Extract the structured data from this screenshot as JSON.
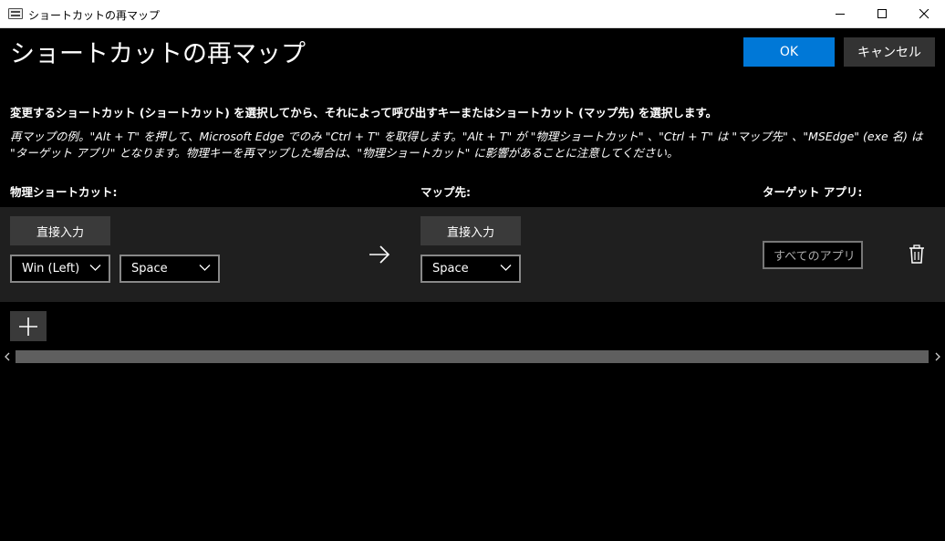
{
  "window": {
    "title": "ショートカットの再マップ",
    "icon": "keyboard-icon"
  },
  "header": {
    "title": "ショートカットの再マップ",
    "ok_label": "OK",
    "cancel_label": "キャンセル",
    "accent_color": "#0078d7"
  },
  "description": "変更するショートカット (ショートカット) を選択してから、それによって呼び出すキーまたはショートカット (マップ先) を選択します。",
  "example": "再マップの例。\"Alt + T\" を押して、Microsoft Edge でのみ \"Ctrl + T\" を取得します。\"Alt + T\" が \"物理ショートカット\" 、\"Ctrl + T\" は \"マップ先\" 、\"MSEdge\" (exe 名) は \"ターゲット アプリ\" となります。物理キーを再マップした場合は、\"物理ショートカット\" に影響があることに注意してください。",
  "columns": {
    "physical": "物理ショートカット:",
    "mapped": "マップ先:",
    "target": "ターゲット アプリ:"
  },
  "row": {
    "physical_type_label": "直接入力",
    "physical_keys": [
      "Win (Left)",
      "Space"
    ],
    "mapped_type_label": "直接入力",
    "mapped_keys": [
      "Space"
    ],
    "target_app_placeholder": "すべてのアプリ",
    "arrow_icon": "arrow-right-icon",
    "delete_icon": "trash-icon"
  },
  "add_icon": "plus-icon"
}
